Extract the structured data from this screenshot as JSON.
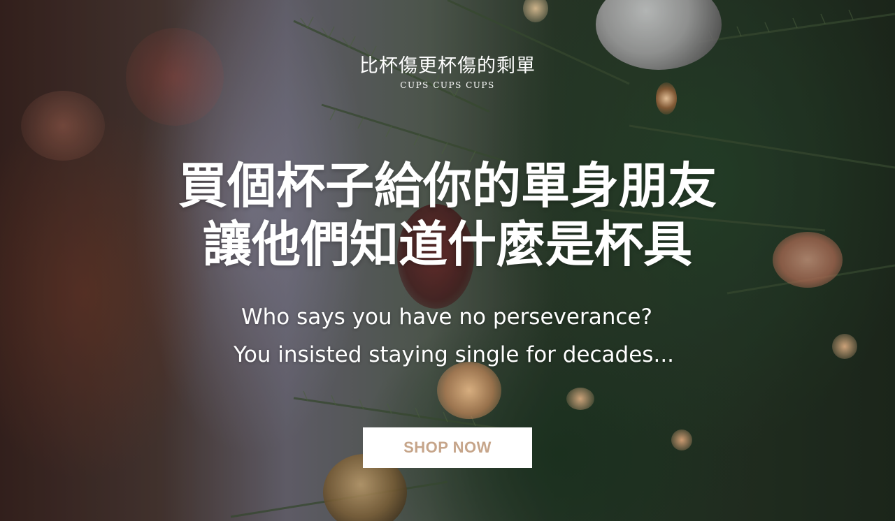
{
  "brand": {
    "name": "比杯傷更杯傷的剩單",
    "subtitle": "CUPS CUPS CUPS"
  },
  "hero": {
    "headline_line1": "買個杯子給你的單身朋友",
    "headline_line2": "讓他們知道什麼是杯具",
    "tagline_line1": "Who says you have no perseverance?",
    "tagline_line2": "You insisted staying single for decades..."
  },
  "cta": {
    "label": "SHOP NOW",
    "text_color": "#c6a58a",
    "background_color": "#ffffff"
  },
  "background": {
    "description_icons": [
      "christmas-tree-image",
      "silver-ornament",
      "gold-ornament",
      "string-lights"
    ]
  }
}
